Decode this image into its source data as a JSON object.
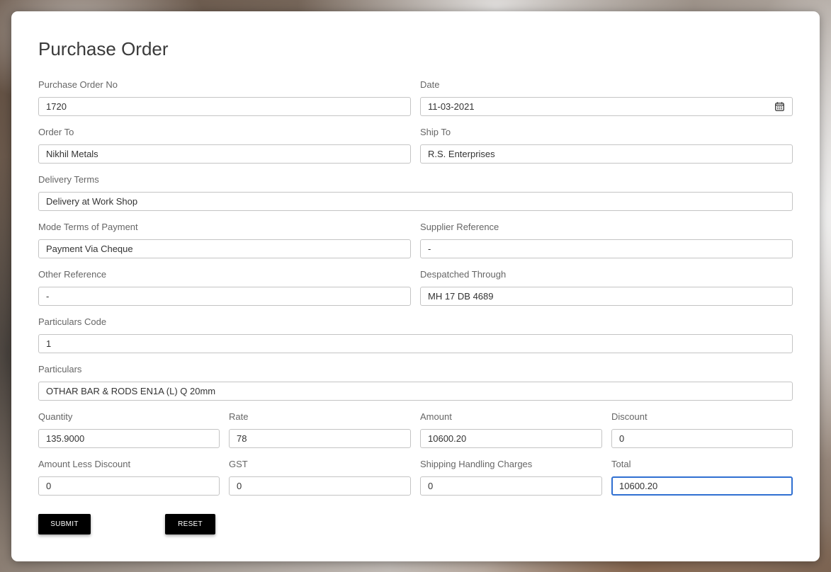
{
  "form": {
    "title": "Purchase Order",
    "fields": {
      "po_no": {
        "label": "Purchase Order No",
        "value": "1720"
      },
      "date": {
        "label": "Date",
        "value": "11-03-2021"
      },
      "order_to": {
        "label": "Order To",
        "value": "Nikhil Metals"
      },
      "ship_to": {
        "label": "Ship To",
        "value": "R.S. Enterprises"
      },
      "delivery_terms": {
        "label": "Delivery Terms",
        "value": "Delivery at Work Shop"
      },
      "payment_mode": {
        "label": "Mode Terms of Payment",
        "value": "Payment Via Cheque"
      },
      "supplier_ref": {
        "label": "Supplier Reference",
        "value": "-"
      },
      "other_ref": {
        "label": "Other Reference",
        "value": "-"
      },
      "despatched": {
        "label": "Despatched Through",
        "value": "MH 17 DB 4689"
      },
      "particulars_code": {
        "label": "Particulars Code",
        "value": "1"
      },
      "particulars": {
        "label": "Particulars",
        "value": "OTHAR BAR & RODS EN1A (L) Q 20mm"
      },
      "quantity": {
        "label": "Quantity",
        "value": "135.9000"
      },
      "rate": {
        "label": "Rate",
        "value": "78"
      },
      "amount": {
        "label": "Amount",
        "value": "10600.20"
      },
      "discount": {
        "label": "Discount",
        "value": "0"
      },
      "amount_less_discount": {
        "label": "Amount Less Discount",
        "value": "0"
      },
      "gst": {
        "label": "GST",
        "value": "0"
      },
      "shipping": {
        "label": "Shipping Handling Charges",
        "value": "0"
      },
      "total": {
        "label": "Total",
        "value": "10600.20"
      }
    },
    "buttons": {
      "submit": "SUBMIT",
      "reset": "RESET"
    },
    "colors": {
      "focus_border": "#2f6fd1",
      "button_bg": "#000000"
    },
    "icons": {
      "date": "calendar-icon"
    }
  }
}
